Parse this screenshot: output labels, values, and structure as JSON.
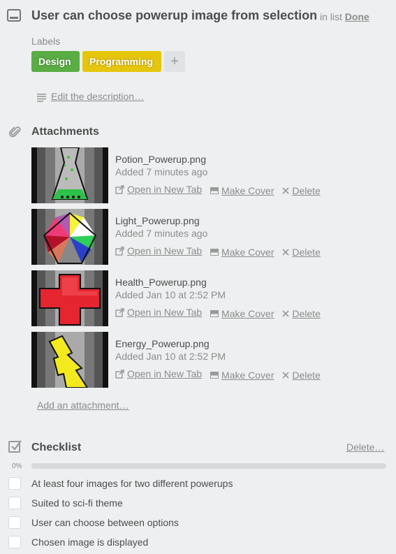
{
  "card": {
    "title": "User can choose powerup image from selection",
    "in_list_prefix": "in list",
    "list_name": "Done"
  },
  "labels": {
    "heading": "Labels",
    "items": [
      {
        "text": "Design",
        "color": "#5aac44"
      },
      {
        "text": "Programming",
        "color": "#e6c60d"
      }
    ],
    "add": "+"
  },
  "description": {
    "link": "Edit the description…"
  },
  "attachments": {
    "title": "Attachments",
    "items": [
      {
        "name": "Potion_Powerup.png",
        "added": "Added 7 minutes ago",
        "thumb_icon": "potion-flask-icon"
      },
      {
        "name": "Light_Powerup.png",
        "added": "Added 7 minutes ago",
        "thumb_icon": "rainbow-pentagon-icon"
      },
      {
        "name": "Health_Powerup.png",
        "added": "Added Jan 10 at 2:52 PM",
        "thumb_icon": "red-cross-icon"
      },
      {
        "name": "Energy_Powerup.png",
        "added": "Added Jan 10 at 2:52 PM",
        "thumb_icon": "lightning-bolt-icon"
      }
    ],
    "actions": {
      "open": "Open in New Tab",
      "cover": "Make Cover",
      "delete": "Delete"
    },
    "add_link": "Add an attachment…"
  },
  "checklist": {
    "title": "Checklist",
    "delete": "Delete…",
    "progress_label": "0%",
    "progress": 0,
    "items": [
      {
        "text": "At least four images for two different powerups",
        "checked": false
      },
      {
        "text": "Suited to sci-fi theme",
        "checked": false
      },
      {
        "text": "User can choose between options",
        "checked": false
      },
      {
        "text": "Chosen image is displayed",
        "checked": false
      }
    ]
  },
  "colors": {
    "background": "#edeff0",
    "muted": "#8c8c8c",
    "progress_fill": "#5ba4cf"
  }
}
